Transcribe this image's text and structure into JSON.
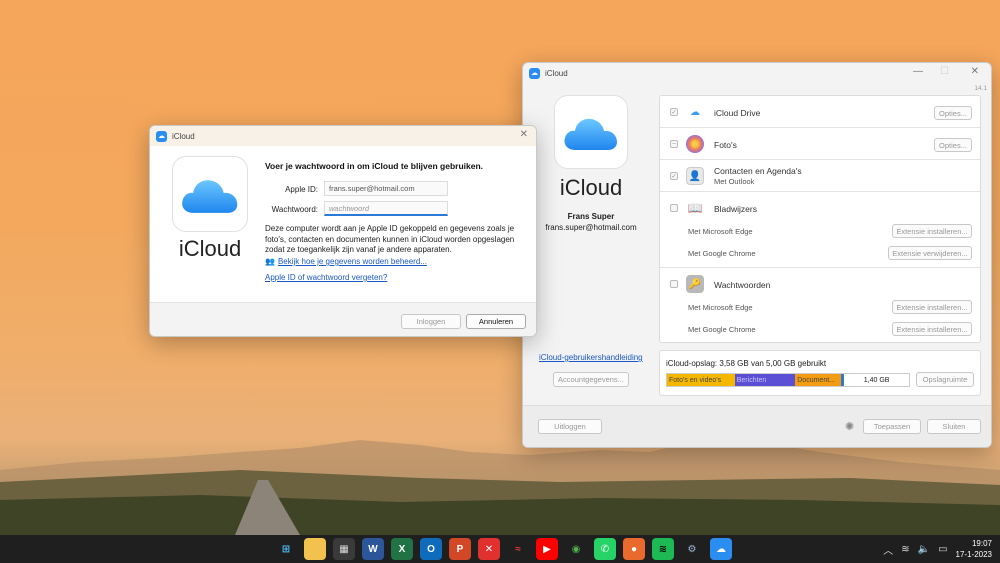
{
  "colors": {
    "accent": "#2b7ad8",
    "photos_segment": "#f5b800",
    "messages_segment": "#5b4fd6",
    "documents_segment": "#f39c12",
    "link": "#1a58c8"
  },
  "main_window": {
    "title": "iCloud",
    "version": "14.1",
    "logo_text": "iCloud",
    "user_name": "Frans Super",
    "user_email": "frans.super@hotmail.com",
    "guide_link": "iCloud-gebruikershandleiding",
    "account_details_button": "Accountgegevens...",
    "services": [
      {
        "name": "iCloud Drive",
        "icon": "icloud-drive-icon",
        "button": "Opties..."
      },
      {
        "name": "Foto's",
        "icon": "photos-icon",
        "button": "Opties..."
      },
      {
        "name": "Contacten en Agenda's",
        "sub": "Met Outlook",
        "icon": "contacts-calendar-icon"
      },
      {
        "name": "Bladwijzers",
        "icon": "bookmarks-icon",
        "rows": [
          {
            "label": "Met Microsoft Edge",
            "button": "Extensie installeren..."
          },
          {
            "label": "Met Google Chrome",
            "button": "Extensie verwijderen..."
          }
        ]
      },
      {
        "name": "Wachtwoorden",
        "icon": "passwords-key-icon",
        "rows": [
          {
            "label": "Met Microsoft Edge",
            "button": "Extensie installeren..."
          },
          {
            "label": "Met Google Chrome",
            "button": "Extensie installeren..."
          }
        ]
      }
    ],
    "storage": {
      "title": "iCloud-opslag: 3,58 GB van 5,00 GB gebruikt",
      "segments": [
        {
          "label": "Foto's en video's",
          "fraction": 0.28
        },
        {
          "label": "Berichten",
          "fraction": 0.25
        },
        {
          "label": "Document...",
          "fraction": 0.19
        }
      ],
      "free": "1,40 GB",
      "manage_button": "Opslagruimte"
    },
    "signout_button": "Uitloggen",
    "apply_button": "Toepassen",
    "close_button": "Sluiten"
  },
  "dialog": {
    "title": "iCloud",
    "logo_text": "iCloud",
    "heading": "Voer je wachtwoord in om iCloud te blijven gebruiken.",
    "apple_id_label": "Apple ID:",
    "apple_id_value": "frans.super@hotmail.com",
    "password_label": "Wachtwoord:",
    "password_placeholder": "wachtwoord",
    "info": "Deze computer wordt aan je Apple ID gekoppeld en gegevens zoals je foto's, contacten en documenten kunnen in iCloud worden opgeslagen zodat ze toegankelijk zijn vanaf je andere apparaten.",
    "data_link": "Bekijk hoe je gegevens worden beheerd...",
    "forgot_link": "Apple ID of wachtwoord vergeten?",
    "login_button": "Inloggen",
    "cancel_button": "Annuleren"
  },
  "taskbar": {
    "apps": [
      {
        "name": "start-icon",
        "glyph": "⊞",
        "color": "#1f1f1f",
        "fg": "#4cc2ff"
      },
      {
        "name": "file-explorer-icon",
        "glyph": "▬",
        "color": "#f2c14e",
        "fg": "#f2c14e"
      },
      {
        "name": "calculator-icon",
        "glyph": "▦",
        "color": "#3a3a3a",
        "fg": "#ddd"
      },
      {
        "name": "word-icon",
        "glyph": "W",
        "color": "#2b579a",
        "fg": "#fff"
      },
      {
        "name": "excel-icon",
        "glyph": "X",
        "color": "#217346",
        "fg": "#fff"
      },
      {
        "name": "outlook-icon",
        "glyph": "O",
        "color": "#0f6cbd",
        "fg": "#fff"
      },
      {
        "name": "powerpoint-icon",
        "glyph": "P",
        "color": "#d24726",
        "fg": "#fff"
      },
      {
        "name": "xmind-icon",
        "glyph": "✕",
        "color": "#e0312f",
        "fg": "#fff"
      },
      {
        "name": "app-red-icon",
        "glyph": "≈",
        "color": "#1f1f1f",
        "fg": "#e03a3a"
      },
      {
        "name": "youtube-icon",
        "glyph": "▶",
        "color": "#ff0000",
        "fg": "#fff"
      },
      {
        "name": "chrome-icon",
        "glyph": "◉",
        "color": "#1f1f1f",
        "fg": "#4caf50"
      },
      {
        "name": "whatsapp-icon",
        "glyph": "✆",
        "color": "#25d366",
        "fg": "#fff"
      },
      {
        "name": "screen-recorder-icon",
        "glyph": "●",
        "color": "#e96a2c",
        "fg": "#fff"
      },
      {
        "name": "spotify-icon",
        "glyph": "≋",
        "color": "#1db954",
        "fg": "#000"
      },
      {
        "name": "settings-icon",
        "glyph": "⚙",
        "color": "#1f1f1f",
        "fg": "#9db8d8"
      },
      {
        "name": "icloud-taskbar-icon",
        "glyph": "☁",
        "color": "#2a8df0",
        "fg": "#fff"
      }
    ],
    "time": "19:07",
    "date": "17-1-2023"
  }
}
